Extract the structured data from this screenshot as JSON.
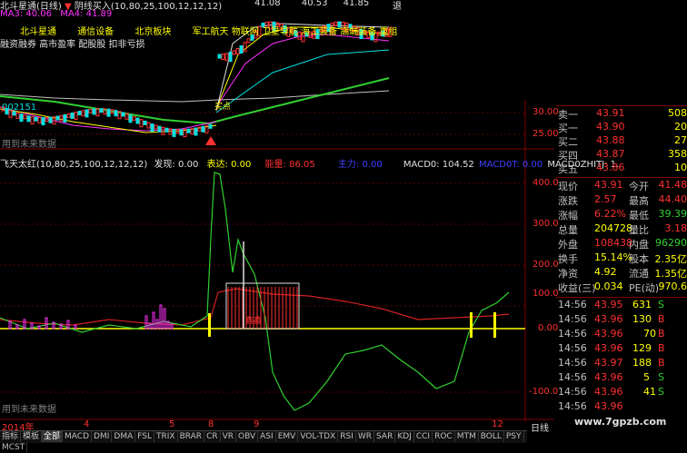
{
  "top_header": {
    "ticker_name": "北斗星通(日线)",
    "indicator_label": "阴线买入(10,80,25,100,12,12,12)",
    "price1": "41.08",
    "price2": "40.53",
    "price3": "41.85",
    "ma_labels": [
      "MA3: 40.06",
      "MA4: 41.89"
    ],
    "exit_label": "退"
  },
  "concept_tags": [
    "北斗星通",
    "通信设备",
    "北京板块",
    "军工航天",
    "物联网",
    "卫星导航",
    "海工装备",
    "高端装备",
    "重组"
  ],
  "margin_row": "融资融券 高市盈率 配股股 扣非亏损",
  "code_label": "002151",
  "warning_text": "用到未来数据",
  "sub_indicator": {
    "name": "飞天太红(10,80,25,100,12,12,12)",
    "fx": "发现: 0.00",
    "bd": "表达: 0.00",
    "nl": "能量: 86.05",
    "jf": "主力: 0.00",
    "macd0": "MACD0: 104.52",
    "macd0t": "MACD0T: 0.00",
    "macd0zh": "MACD0ZHITJ: 1."
  },
  "price_axis": [
    "30.00",
    "25.00"
  ],
  "sub_axis": [
    "400.0",
    "300.0",
    "200.0",
    "100.0",
    "0.00",
    "-100.0"
  ],
  "time_axis": [
    "2014年",
    "4",
    "5",
    "8",
    "9",
    "12"
  ],
  "markers": {
    "buy": "买点",
    "signal": "鑫鑫"
  },
  "order_book": [
    {
      "label": "卖一",
      "price": "43.91",
      "vol": "508"
    },
    {
      "label": "买一",
      "price": "43.90",
      "vol": "20"
    },
    {
      "label": "买二",
      "price": "43.88",
      "vol": "27"
    },
    {
      "label": "买四",
      "price": "43.87",
      "vol": "358"
    },
    {
      "label": "买五",
      "price": "43.86",
      "vol": "10"
    }
  ],
  "stats": [
    {
      "l1": "现价",
      "v1": "43.91",
      "l2": "今开",
      "v2": "41.48"
    },
    {
      "l1": "涨跌",
      "v1": "2.57",
      "l2": "最高",
      "v2": "44.40"
    },
    {
      "l1": "涨幅",
      "v1": "6.22%",
      "l2": "最低",
      "v2": "39.39"
    },
    {
      "l1": "总量",
      "v1": "204728",
      "l2": "量比",
      "v2": "3.18"
    },
    {
      "l1": "外盘",
      "v1": "108438",
      "l2": "内盘",
      "v2": "96290"
    },
    {
      "l1": "换手",
      "v1": "15.14%",
      "l2": "股本",
      "v2": "2.35亿"
    },
    {
      "l1": "净资",
      "v1": "4.92",
      "l2": "流通",
      "v2": "1.35亿"
    },
    {
      "l1": "收益(三)",
      "v1": "0.034",
      "l2": "PE(动)",
      "v2": "970.6"
    }
  ],
  "ticks": [
    {
      "time": "14:56",
      "price": "43.95",
      "vol": "631",
      "side": "S"
    },
    {
      "time": "14:56",
      "price": "43.96",
      "vol": "130",
      "side": "B"
    },
    {
      "time": "14:56",
      "price": "43.96",
      "vol": "70",
      "side": "B"
    },
    {
      "time": "14:56",
      "price": "43.96",
      "vol": "129",
      "side": "B"
    },
    {
      "time": "14:56",
      "price": "43.97",
      "vol": "188",
      "side": "B"
    },
    {
      "time": "14:56",
      "price": "43.96",
      "vol": "5",
      "side": "S"
    },
    {
      "time": "14:56",
      "price": "43.96",
      "vol": "41",
      "side": "S"
    },
    {
      "time": "14:56",
      "price": "43.96",
      "vol": "",
      "side": ""
    }
  ],
  "day_label": "日线",
  "watermark": "www.7gpzb.com",
  "tabs": [
    "指标",
    "模板",
    "全部",
    "MACD",
    "DMI",
    "DMA",
    "FSL",
    "TRIX",
    "BRAR",
    "CR",
    "VR",
    "OBV",
    "ASI",
    "EMV",
    "VOL-TDX",
    "RSI",
    "WR",
    "SAR",
    "KDJ",
    "CCI",
    "ROC",
    "MTM",
    "BOLL",
    "PSY",
    "MCST"
  ],
  "colors": {
    "up": "#ff3030",
    "down": "#00e0e0",
    "green_line": "#30d030",
    "yellow": "#ffff00",
    "magenta": "#ff30ff"
  }
}
